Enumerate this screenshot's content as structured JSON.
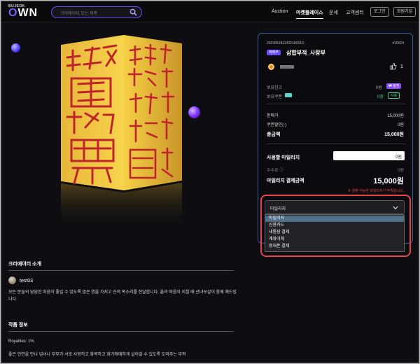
{
  "header": {
    "logo_small": "BUJEOK",
    "logo_big": "OWN",
    "search_placeholder": "크리에이터 또는 제목",
    "nav": [
      "Auction",
      "마켓플레이스",
      "운세",
      "고객센터"
    ],
    "login": "로그인",
    "signup": "회원가입"
  },
  "product": {
    "id": "202305181149216831O",
    "number": "#10024",
    "badge": "예매부",
    "title": "삼합부적_사랑부",
    "likes": "1",
    "points_label": "보유잔고",
    "points_value": "0원",
    "points_tag": "₩ 충전",
    "coupon_label": "보유쿠폰",
    "coupon_value": "0장",
    "coupon_tag": "사용",
    "sale_label": "판매가",
    "sale_value": "15,000원",
    "discount_label": "쿠폰할인(-)",
    "discount_value": "0원",
    "total_label": "총금액",
    "total_value": "15,000원",
    "mileage_label": "사용할 마일리지",
    "mileage_value": "0원",
    "fee_label": "수수료 ⓘ",
    "fee_value": "0원",
    "pay_label": "마일리지 결제금액",
    "pay_value": "15,000원",
    "warning": "※ 결제 가능한 마일리지가 부족합니다."
  },
  "payment": {
    "selected": "마일리지",
    "options": [
      "마일리지",
      "신용카드",
      "내통장 결제",
      "계좌이체",
      "휴대폰 결제"
    ]
  },
  "creator": {
    "section_title": "크리에이터 소개",
    "name": "test03",
    "desc": "모든 분들의 담담한 마음이 좋일 수 있도록 많은 염을 가지고 신의 목소리를 전달합니다. 옮과 마음이 지칠 때 선녀보살이 함께 해드립니다."
  },
  "work": {
    "section_title": "작품 정보",
    "royalties": "Royalties: 1%",
    "desc": "좋은 인연을 만나 넘녀나 부부가 서로 사랑하고 화목하고 화기애애하게 살아갈 수 있도록 도와주는 부적"
  },
  "colors": {
    "accent": "#6a4cff",
    "highlight": "#e8424f",
    "gold": "#f2c431",
    "ink": "#c0242b"
  }
}
